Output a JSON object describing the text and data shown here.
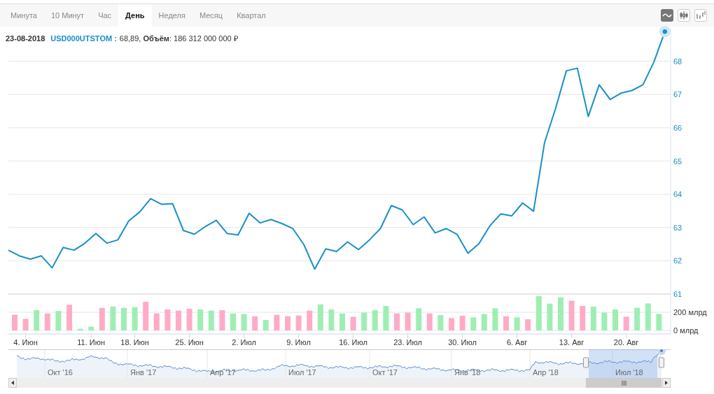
{
  "tabs": [
    {
      "label": "Минута",
      "selected": false
    },
    {
      "label": "10 Минут",
      "selected": false
    },
    {
      "label": "Час",
      "selected": false
    },
    {
      "label": "День",
      "selected": true
    },
    {
      "label": "Неделя",
      "selected": false
    },
    {
      "label": "Месяц",
      "selected": false
    },
    {
      "label": "Квартал",
      "selected": false
    }
  ],
  "chart_types": [
    {
      "kind": "line",
      "selected": true
    },
    {
      "kind": "candlestick",
      "selected": false
    },
    {
      "kind": "ohlc",
      "selected": false
    }
  ],
  "info": {
    "date": "23-08-2018",
    "ticker": "USD000UTSTOM :",
    "values": "68,89, **Объём**: 186 312 000 000 ₽"
  },
  "price_chart": {
    "chart_data": {
      "type": "line",
      "grid": true,
      "ylim": [
        61,
        69
      ],
      "yticks": [
        61,
        62,
        63,
        64,
        65,
        66,
        67,
        68
      ],
      "series": [
        {
          "color": "#1a8fc9",
          "values": [
            62.32,
            62.15,
            62.05,
            62.15,
            61.79,
            62.4,
            62.32,
            62.53,
            62.82,
            62.53,
            62.63,
            63.2,
            63.47,
            63.87,
            63.7,
            63.72,
            62.91,
            62.8,
            63.03,
            63.22,
            62.82,
            62.78,
            63.43,
            63.14,
            63.24,
            63.12,
            62.97,
            62.49,
            61.75,
            62.36,
            62.28,
            62.57,
            62.34,
            62.63,
            62.97,
            63.66,
            63.53,
            63.09,
            63.32,
            62.84,
            62.97,
            62.8,
            62.23,
            62.51,
            63.05,
            63.41,
            63.35,
            63.74,
            63.49,
            65.55,
            66.57,
            67.71,
            67.79,
            66.34,
            67.29,
            66.85,
            67.04,
            67.12,
            67.29,
            67.98,
            68.89
          ]
        }
      ]
    }
  },
  "volume_chart": {
    "chart_data": {
      "type": "bar",
      "grid": true,
      "ylim": [
        0,
        400
      ],
      "yticks": [
        {
          "value": 0,
          "label": "0 млрд"
        },
        {
          "value": 200,
          "label": "200 млрд"
        }
      ],
      "categories": [
        null,
        "4. Июн",
        null,
        null,
        null,
        null,
        null,
        "11. Июн",
        null,
        null,
        null,
        "18. Июн",
        null,
        null,
        null,
        null,
        "25. Июн",
        null,
        null,
        null,
        null,
        "2. Июл",
        null,
        null,
        null,
        null,
        "9. Июл",
        null,
        null,
        null,
        null,
        "16. Июл",
        null,
        null,
        null,
        null,
        "23. Июл",
        null,
        null,
        null,
        null,
        "30. Июл",
        null,
        null,
        null,
        null,
        "6. Авг",
        null,
        null,
        null,
        null,
        "13. Авг",
        null,
        null,
        null,
        null,
        "20. Авг",
        null,
        null,
        null
      ],
      "series": [
        {
          "color": "#9eeeb4",
          "values": [
            null,
            null,
            223,
            null,
            215,
            null,
            18,
            41,
            null,
            262,
            249,
            256,
            null,
            null,
            null,
            null,
            null,
            231,
            218,
            null,
            187,
            182,
            null,
            115,
            null,
            null,
            null,
            null,
            287,
            231,
            187,
            null,
            197,
            223,
            269,
            null,
            null,
            244,
            null,
            169,
            null,
            null,
            144,
            182,
            244,
            null,
            144,
            null,
            377,
            295,
            364,
            null,
            null,
            262,
            197,
            231,
            null,
            249,
            297,
            182
          ]
        },
        {
          "color": "#ffabc6",
          "values": [
            174,
            128,
            null,
            187,
            null,
            282,
            null,
            null,
            249,
            null,
            null,
            null,
            315,
            187,
            231,
            218,
            238,
            null,
            null,
            223,
            null,
            null,
            156,
            null,
            172,
            156,
            164,
            218,
            null,
            null,
            null,
            151,
            null,
            null,
            null,
            187,
            197,
            null,
            187,
            null,
            136,
            162,
            null,
            null,
            null,
            156,
            null,
            123,
            null,
            null,
            null,
            328,
            269,
            null,
            null,
            null,
            151,
            null,
            null,
            null
          ]
        }
      ]
    }
  },
  "navigator": {
    "labels": [
      "Окт '16",
      "Янв '17",
      "Апр '17",
      "Июл '17",
      "Окт '17",
      "Янв '18",
      "Апр '18",
      "Июл '18"
    ]
  }
}
